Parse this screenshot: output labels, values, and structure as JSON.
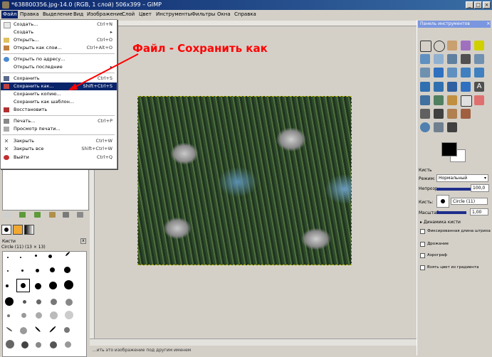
{
  "window": {
    "title": "*638800356.jpg-14.0 (RGB, 1 слой) 506x399 – GIMP",
    "buttons": [
      "_",
      "□",
      "×"
    ]
  },
  "menubar": [
    "Файл",
    "Правка",
    "Выделение",
    "Вид",
    "Изображение",
    "Слой",
    "Цвет",
    "Инструменты",
    "Фильтры",
    "Окна",
    "Справка"
  ],
  "file_menu": {
    "items": [
      {
        "label": "Создать...",
        "shortcut": "Ctrl+N",
        "icon": "new-icon"
      },
      {
        "label": "Создать",
        "shortcut": "",
        "icon": ""
      },
      {
        "label": "Открыть...",
        "shortcut": "Ctrl+O",
        "icon": "open-icon"
      },
      {
        "label": "Открыть как слои...",
        "shortcut": "Ctrl+Alt+O",
        "icon": "open-layers-icon"
      },
      {
        "label": "Открыть по адресу...",
        "shortcut": "",
        "icon": "globe-icon"
      },
      {
        "label": "Открыть последние",
        "shortcut": "",
        "icon": ""
      },
      {
        "label": "Сохранить",
        "shortcut": "Ctrl+S",
        "icon": "save-icon"
      },
      {
        "label": "Сохранить как...",
        "shortcut": "Shift+Ctrl+S",
        "icon": "save-as-icon"
      },
      {
        "label": "Сохранить копию...",
        "shortcut": "",
        "icon": ""
      },
      {
        "label": "Сохранить как шаблон...",
        "shortcut": "",
        "icon": ""
      },
      {
        "label": "Восстановить",
        "shortcut": "",
        "icon": "revert-icon"
      },
      {
        "label": "Печать...",
        "shortcut": "Ctrl+P",
        "icon": "print-icon"
      },
      {
        "label": "Просмотр печати...",
        "shortcut": "",
        "icon": "print-preview-icon"
      },
      {
        "label": "Закрыть",
        "shortcut": "Ctrl+W",
        "icon": "close-icon"
      },
      {
        "label": "Закрыть все",
        "shortcut": "Shift+Ctrl+W",
        "icon": "close-all-icon"
      },
      {
        "label": "Выйти",
        "shortcut": "Ctrl+Q",
        "icon": "quit-icon"
      }
    ]
  },
  "annotation": "Файл - Сохранить как",
  "status_text": "...ить это изображение под другим именем",
  "toolbox": {
    "title": "Панель инструментов",
    "colors": {
      "foreground": "#000000",
      "background": "#ffffff"
    }
  },
  "tool_options": {
    "title": "Кисть",
    "mode_label": "Режим:",
    "mode_value": "Нормальный",
    "opacity_label": "Непрозр.:",
    "opacity_value": "100,0",
    "brush_label": "Кисть:",
    "brush_value": "Circle (11)",
    "scale_label": "Масштаб:",
    "scale_value": "1,00",
    "dynamics_label": "Динамика кисти",
    "checkboxes": [
      "Фиксированная длина штриха",
      "Дрожание",
      "Аэрограф",
      "Взять цвет из градиента"
    ]
  },
  "brushes_panel": {
    "title": "Кисти",
    "subtitle": "Circle (11) (13 × 13)"
  }
}
